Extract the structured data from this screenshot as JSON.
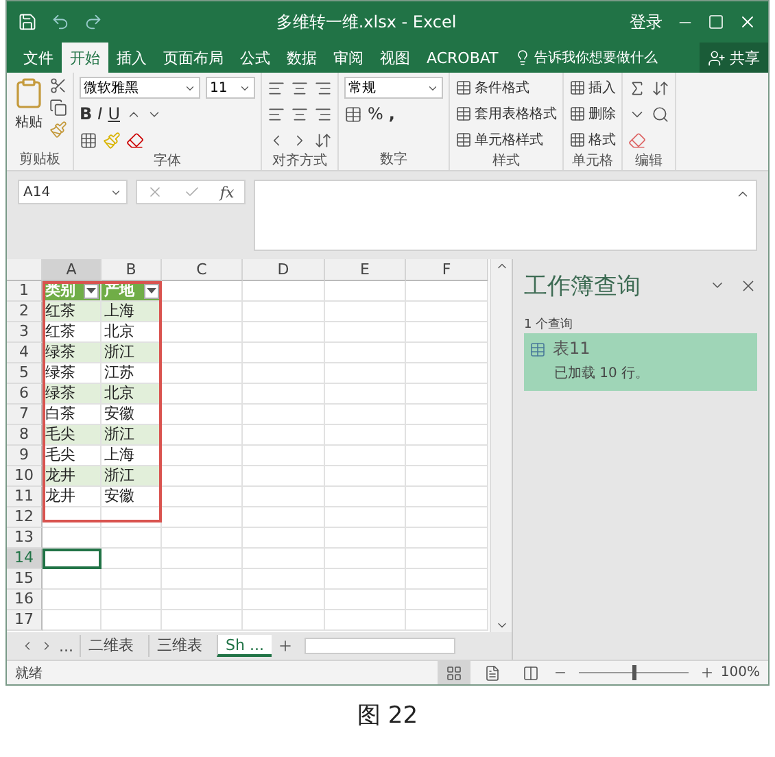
{
  "title_bar": {
    "title": "多维转一维.xlsx - Excel",
    "sign_in": "登录"
  },
  "menu_tabs": [
    {
      "label": "文件",
      "selected": false
    },
    {
      "label": "开始",
      "selected": true
    },
    {
      "label": "插入",
      "selected": false
    },
    {
      "label": "页面布局",
      "selected": false
    },
    {
      "label": "公式",
      "selected": false
    },
    {
      "label": "数据",
      "selected": false
    },
    {
      "label": "审阅",
      "selected": false
    },
    {
      "label": "视图",
      "selected": false
    },
    {
      "label": "ACROBAT",
      "selected": false
    }
  ],
  "tell_me": "告诉我你想要做什么",
  "share": "共享",
  "ribbon": {
    "clipboard": {
      "paste": "粘贴",
      "label": "剪贴板"
    },
    "font": {
      "name": "微软雅黑",
      "size": "11",
      "bold": "B",
      "italic": "I",
      "underline": "U",
      "label": "字体"
    },
    "alignment": {
      "label": "对齐方式"
    },
    "number": {
      "format": "常规",
      "percent": "%",
      "comma": ",",
      "label": "数字"
    },
    "styles": {
      "items": [
        "条件格式",
        "套用表格格式",
        "单元格样式"
      ],
      "label": "样式"
    },
    "cells": {
      "items": [
        "插入",
        "删除",
        "格式"
      ],
      "label": "单元格"
    },
    "editing": {
      "label": "编辑"
    }
  },
  "formula_bar": {
    "name_box": "A14",
    "fx": "fx"
  },
  "columns": [
    {
      "label": "A",
      "selected": true
    },
    {
      "label": "B",
      "selected": false
    },
    {
      "label": "C",
      "selected": false
    },
    {
      "label": "D",
      "selected": false
    },
    {
      "label": "E",
      "selected": false
    },
    {
      "label": "F",
      "selected": false
    }
  ],
  "rows": [
    {
      "number": "1",
      "kind": "header",
      "selected": false,
      "cells": [
        "类别",
        "产地"
      ]
    },
    {
      "number": "2",
      "kind": "data",
      "selected": false,
      "cells": [
        "红茶",
        "上海"
      ]
    },
    {
      "number": "3",
      "kind": "data",
      "selected": false,
      "cells": [
        "红茶",
        "北京"
      ]
    },
    {
      "number": "4",
      "kind": "data",
      "selected": false,
      "cells": [
        "绿茶",
        "浙江"
      ]
    },
    {
      "number": "5",
      "kind": "data",
      "selected": false,
      "cells": [
        "绿茶",
        "江苏"
      ]
    },
    {
      "number": "6",
      "kind": "data",
      "selected": false,
      "cells": [
        "绿茶",
        "北京"
      ]
    },
    {
      "number": "7",
      "kind": "data",
      "selected": false,
      "cells": [
        "白茶",
        "安徽"
      ]
    },
    {
      "number": "8",
      "kind": "data",
      "selected": false,
      "cells": [
        "毛尖",
        "浙江"
      ]
    },
    {
      "number": "9",
      "kind": "data",
      "selected": false,
      "cells": [
        "毛尖",
        "上海"
      ]
    },
    {
      "number": "10",
      "kind": "data",
      "selected": false,
      "cells": [
        "龙井",
        "浙江"
      ]
    },
    {
      "number": "11",
      "kind": "data",
      "selected": false,
      "cells": [
        "龙井",
        "安徽"
      ]
    },
    {
      "number": "12",
      "kind": "empty",
      "selected": false
    },
    {
      "number": "13",
      "kind": "empty",
      "selected": false
    },
    {
      "number": "14",
      "kind": "empty",
      "selected": true
    },
    {
      "number": "15",
      "kind": "empty",
      "selected": false
    },
    {
      "number": "16",
      "kind": "empty",
      "selected": false
    },
    {
      "number": "17",
      "kind": "empty",
      "selected": false
    }
  ],
  "sheet_tabs": {
    "more": "...",
    "tabs": [
      {
        "label": "二维表",
        "selected": false
      },
      {
        "label": "三维表",
        "selected": false
      },
      {
        "label": "Sh ...",
        "selected": true
      }
    ]
  },
  "query_pane": {
    "title": "工作簿查询",
    "count": "1 个查询",
    "queries": [
      {
        "name": "表11",
        "status": "已加载 10 行。",
        "selected": true
      }
    ]
  },
  "status_bar": {
    "status": "就绪",
    "views": [
      {
        "kind": "normal",
        "selected": true
      },
      {
        "kind": "layout",
        "selected": false
      },
      {
        "kind": "break",
        "selected": false
      }
    ],
    "zoom": {
      "level": 0.5,
      "label": "100%"
    }
  },
  "caption": "图 22"
}
